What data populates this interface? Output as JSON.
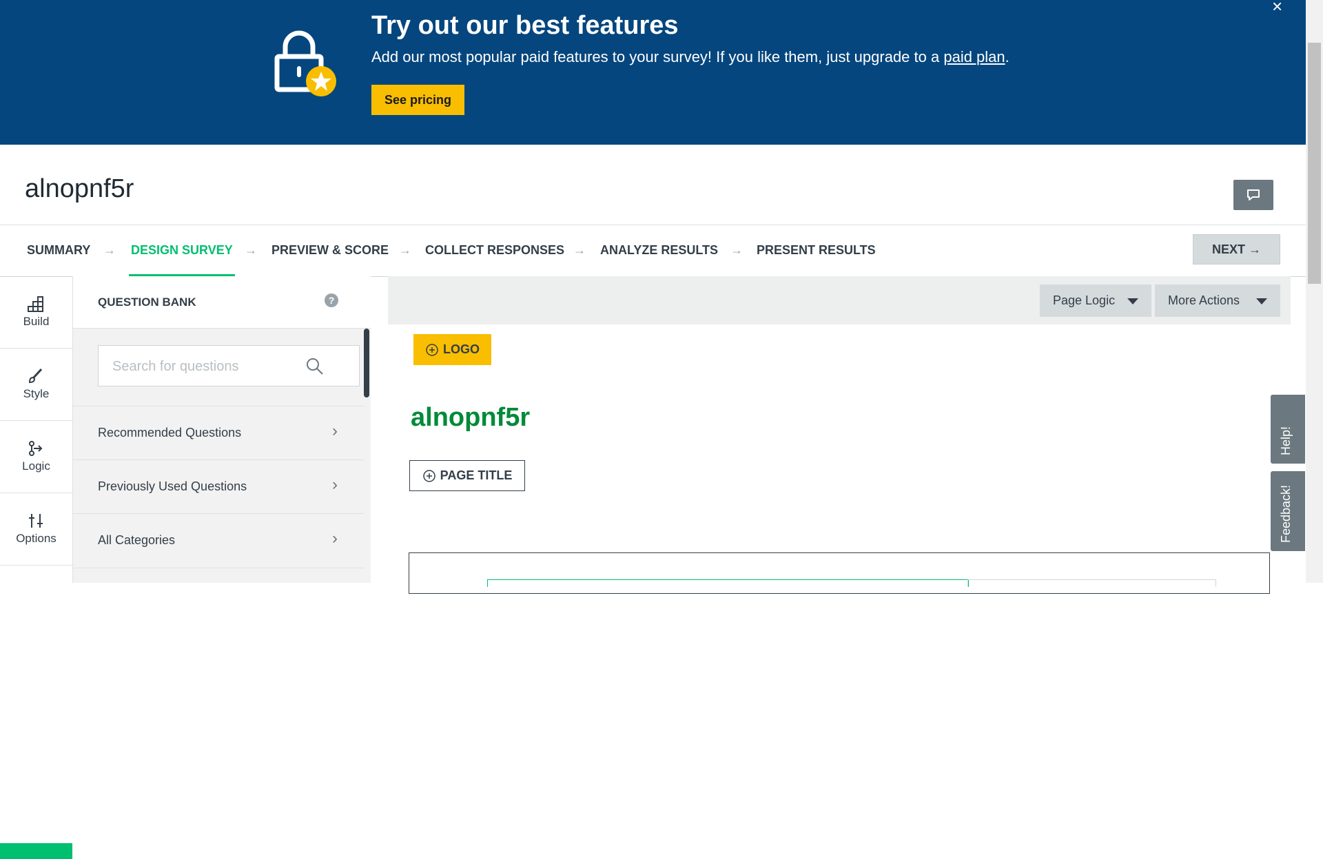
{
  "banner": {
    "title": "Try out our best features",
    "text_before_link": "Add our most popular paid features to your survey! If you like them, just upgrade to a ",
    "link_text": "paid plan",
    "text_after_link": ".",
    "cta": "See pricing",
    "close_symbol": "×",
    "colors": {
      "background": "#05467e",
      "cta": "#f9be00"
    }
  },
  "survey": {
    "title": "alnopnf5r"
  },
  "steps": [
    {
      "label": "SUMMARY",
      "active": false
    },
    {
      "label": "DESIGN SURVEY",
      "active": true
    },
    {
      "label": "PREVIEW & SCORE",
      "active": false
    },
    {
      "label": "COLLECT RESPONSES",
      "active": false
    },
    {
      "label": "ANALYZE RESULTS",
      "active": false
    },
    {
      "label": "PRESENT RESULTS",
      "active": false
    }
  ],
  "next_label": "NEXT",
  "rail": [
    {
      "label": "Build",
      "icon": "build-icon"
    },
    {
      "label": "Style",
      "icon": "brush-icon"
    },
    {
      "label": "Logic",
      "icon": "logic-icon"
    },
    {
      "label": "Options",
      "icon": "options-icon"
    }
  ],
  "question_bank": {
    "title": "QUESTION BANK",
    "help": "?",
    "search_placeholder": "Search for questions",
    "rows": [
      "Recommended Questions",
      "Previously Used Questions",
      "All Categories"
    ]
  },
  "canvas": {
    "page_logic": "Page Logic",
    "more_actions": "More Actions",
    "logo_button": "LOGO",
    "survey_title": "alnopnf5r",
    "page_title_button": "PAGE TITLE"
  },
  "side_tabs": {
    "help": "Help!",
    "feedback": "Feedback!"
  },
  "accent_colors": {
    "green": "#00bf6f",
    "title_green": "#008a39",
    "yellow": "#f9be00"
  }
}
